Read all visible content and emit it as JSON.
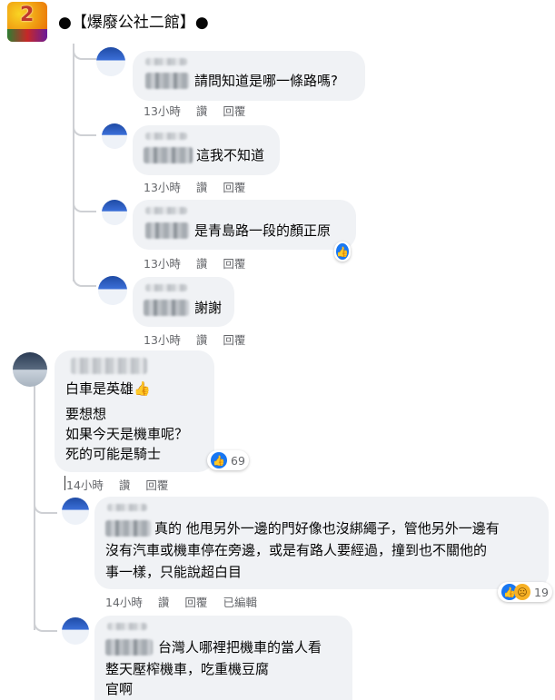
{
  "group": {
    "title": "●【爆廢公社二館】●",
    "logo_text": "2"
  },
  "comments": [
    {
      "text": "請問知道是哪一條路嗎?",
      "time": "13小時",
      "like": "讚",
      "reply": "回覆"
    },
    {
      "text": "這我不知道",
      "time": "13小時",
      "like": "讚",
      "reply": "回覆"
    },
    {
      "text": "是青島路一段的顏正原",
      "time": "13小時",
      "like": "讚",
      "reply": "回覆"
    },
    {
      "text": "謝謝",
      "time": "13小時",
      "like": "讚",
      "reply": "回覆"
    },
    {
      "line1": "白車是英雄👍",
      "line2": "要想想",
      "line3": "如果今天是機車呢？",
      "line4": "死的可能是騎士",
      "reactions": "69",
      "time": "14小時",
      "like": "讚",
      "reply": "回覆"
    },
    {
      "line1": "真的 他甩另外一邊的門好像也沒綁繩子，管他另外一邊有",
      "line2": "沒有汽車或機車停在旁邊，或是有路人要經過，撞到也不關他的",
      "line3": "事一樣，只能說超白目",
      "reactions": "19",
      "time": "14小時",
      "like": "讚",
      "reply": "回覆",
      "edited": "已編輯"
    },
    {
      "line1": "台灣人哪裡把機車的當人看",
      "line2": "整天壓榨機車，吃重機豆腐",
      "line3": "官啊"
    }
  ],
  "icons": {
    "like": "like-icon",
    "sad": "sad-icon"
  },
  "colors": {
    "bubble": "#f0f2f5",
    "like_blue": "#1877f2",
    "meta_gray": "#65676b"
  }
}
